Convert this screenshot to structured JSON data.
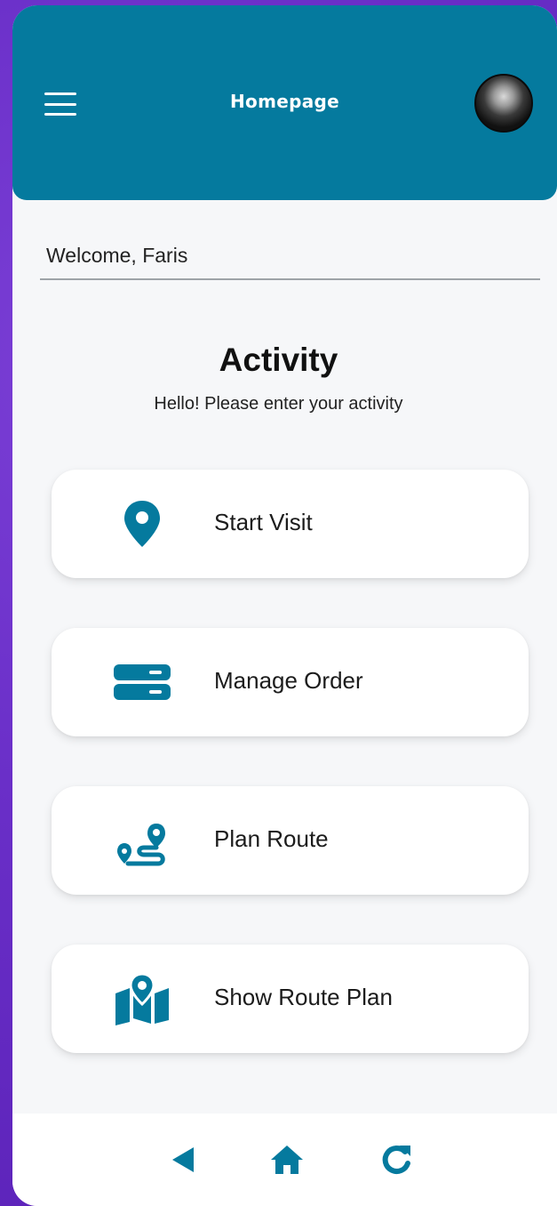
{
  "header": {
    "title": "Homepage",
    "accent_color": "#057a9e",
    "menu_icon": "hamburger-menu-icon",
    "avatar": "user-avatar-photo"
  },
  "welcome_text": "Welcome, Faris",
  "activity": {
    "title": "Activity",
    "subtitle": "Hello! Please enter your activity",
    "items": [
      {
        "label": "Start Visit",
        "icon": "map-pin-icon"
      },
      {
        "label": "Manage Order",
        "icon": "server-stack-icon"
      },
      {
        "label": "Plan Route",
        "icon": "route-icon"
      },
      {
        "label": "Show Route Plan",
        "icon": "map-location-icon"
      }
    ]
  },
  "bottom_nav": {
    "items": [
      {
        "icon": "back-icon"
      },
      {
        "icon": "home-icon"
      },
      {
        "icon": "refresh-icon"
      }
    ]
  }
}
